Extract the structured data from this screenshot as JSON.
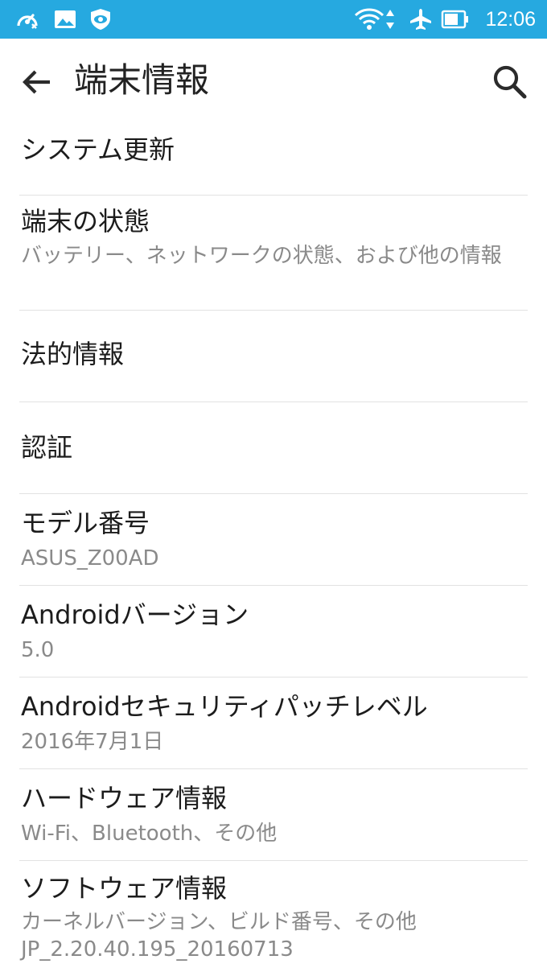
{
  "status_bar": {
    "time": "12:06",
    "background_color": "#26a9e0",
    "left_icons": [
      "speed-icon",
      "image-icon",
      "shield-eye-icon"
    ],
    "right_icons": [
      "wifi-icon",
      "data-arrows-icon",
      "airplane-icon",
      "battery-icon"
    ]
  },
  "toolbar": {
    "title": "端末情報",
    "back_icon": "back-arrow-icon",
    "search_icon": "search-icon"
  },
  "items": [
    {
      "label": "システム更新"
    },
    {
      "label": "端末の状態",
      "summary": "バッテリー、ネットワークの状態、および他の情報"
    },
    {
      "label": "法的情報"
    },
    {
      "label": "認証"
    },
    {
      "label": "モデル番号",
      "summary": "ASUS_Z00AD"
    },
    {
      "label": "Androidバージョン",
      "summary": "5.0"
    },
    {
      "label": "Androidセキュリティパッチレベル",
      "summary": "2016年7月1日"
    },
    {
      "label": "ハードウェア情報",
      "summary": "Wi-Fi、Bluetooth、その他"
    },
    {
      "label": "ソフトウェア情報",
      "summary": "カーネルバージョン、ビルド番号、その他",
      "summary2": "JP_2.20.40.195_20160713"
    }
  ]
}
